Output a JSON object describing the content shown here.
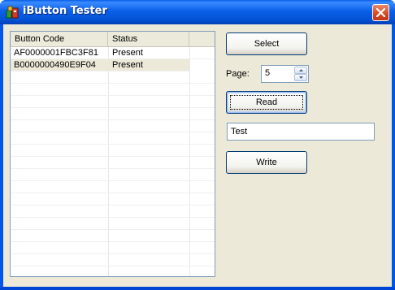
{
  "window": {
    "title": "iButton Tester",
    "colors": {
      "titlebar": "#0055ea",
      "close_button": "#d6471f",
      "client_background": "#ece9d8"
    }
  },
  "list": {
    "columns": [
      "Button Code",
      "Status",
      ""
    ],
    "rows": [
      {
        "code": "AF0000001FBC3F81",
        "status": "Present"
      },
      {
        "code": "B0000000490E9F04",
        "status": "Present"
      }
    ]
  },
  "buttons": {
    "select": "Select",
    "read": "Read",
    "write": "Write"
  },
  "page": {
    "label": "Page:",
    "value": "5"
  },
  "text_field": {
    "value": "Test"
  },
  "icons": {
    "app": "ibutton-app-icon",
    "close": "close-icon",
    "spin_up": "arrow-up-icon",
    "spin_down": "arrow-down-icon"
  }
}
